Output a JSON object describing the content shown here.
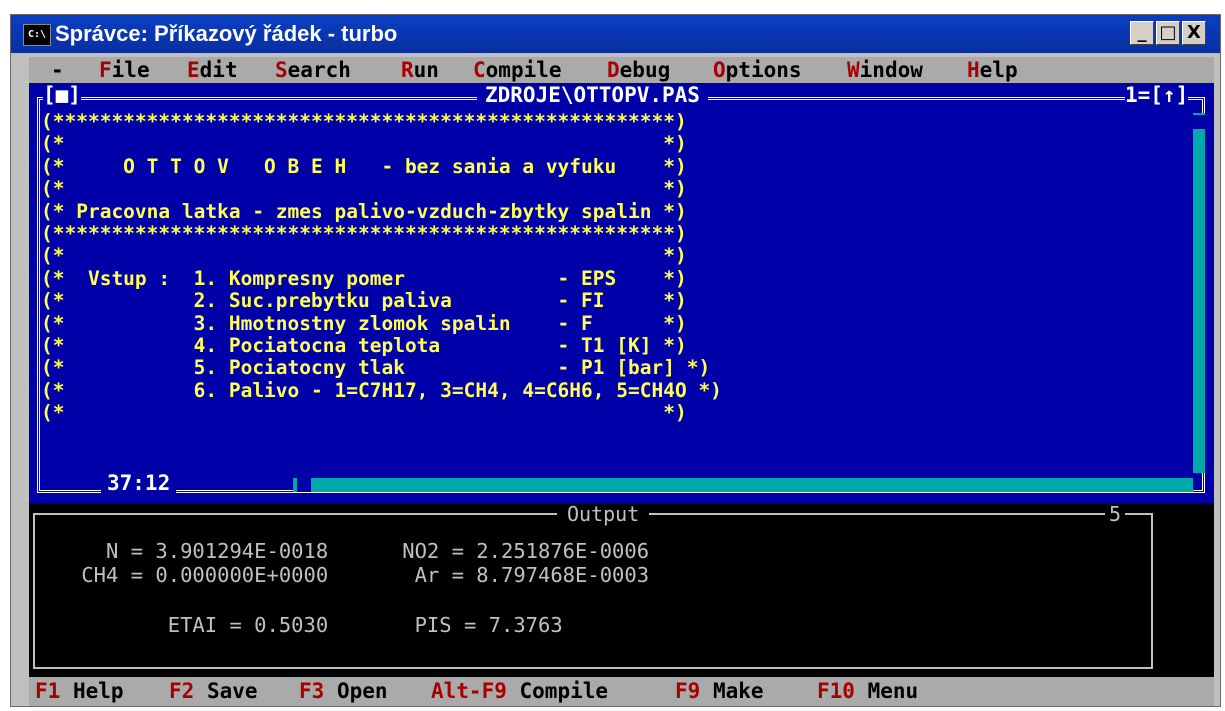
{
  "window": {
    "title": "Správce: Příkazový řádek - turbo",
    "icon_text": "C:\\",
    "controls": {
      "minimize": "_",
      "maximize": "□",
      "close": "X"
    }
  },
  "menu": {
    "system": "-",
    "items": [
      {
        "hot": "F",
        "rest": "ile"
      },
      {
        "hot": "E",
        "rest": "dit"
      },
      {
        "hot": "S",
        "rest": "earch"
      },
      {
        "hot": "R",
        "rest": "un"
      },
      {
        "hot": "C",
        "rest": "ompile"
      },
      {
        "hot": "D",
        "rest": "ebug"
      },
      {
        "hot": "O",
        "rest": "ptions"
      },
      {
        "hot": "W",
        "rest": "indow"
      },
      {
        "hot": "H",
        "rest": "elp"
      }
    ]
  },
  "editor": {
    "filename": "ZDROJE\\OTTOPV.PAS",
    "close_box": "[■]",
    "window_number": "1=[↑]",
    "cursor_position": "37:12",
    "lines": [
      "(*****************************************************)",
      "(*                                                   *)",
      "(*     O T T O V   O B E H   - bez sania a vyfuku    *)",
      "(*                                                   *)",
      "(* Pracovna latka - zmes palivo-vzduch-zbytky spalin *)",
      "(*****************************************************)",
      "(*                                                   *)",
      "(*  Vstup :  1. Kompresny pomer             - EPS    *)",
      "(*           2. Suc.prebytku paliva         - FI     *)",
      "(*           3. Hmotnostny zlomok spalin    - F      *)",
      "(*           4. Pociatocna teplota          - T1 [K] *)",
      "(*           5. Pociatocny tlak             - P1 [bar] *)",
      "(*           6. Palivo - 1=C7H17, 3=CH4, 4=C6H6, 5=CH4O *)",
      "(*                                                   *)"
    ]
  },
  "output": {
    "title": "Output",
    "window_number": "5",
    "rows": [
      "   N = 3.901294E-0018      NO2 = 2.251876E-0006",
      " CH4 = 0.000000E+0000       Ar = 8.797468E-0003",
      "",
      "        ETAI = 0.5030       PIS = 7.3763"
    ]
  },
  "status": [
    {
      "key": "F1",
      "label": "Help"
    },
    {
      "key": "F2",
      "label": "Save"
    },
    {
      "key": "F3",
      "label": "Open"
    },
    {
      "key": "Alt-F9",
      "label": "Compile"
    },
    {
      "key": "F9",
      "label": "Make"
    },
    {
      "key": "F10",
      "label": "Menu"
    }
  ]
}
